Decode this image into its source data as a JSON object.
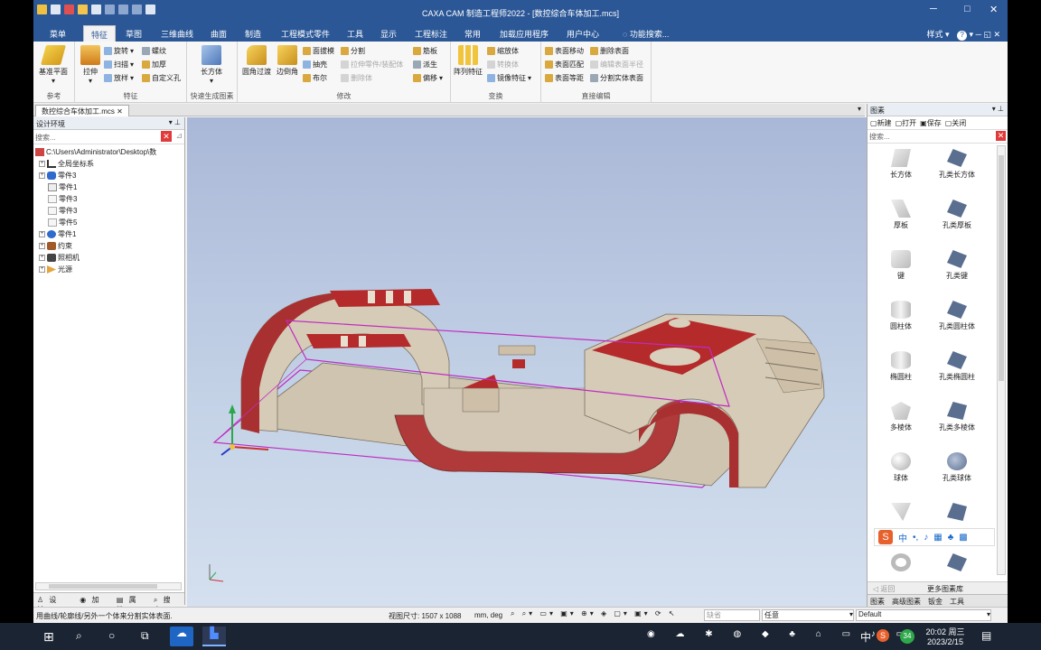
{
  "app": {
    "title": "CAXA CAM 制造工程师2022 - [数控综合车体加工.mcs]",
    "minimize": "─",
    "maximize": "□",
    "close": "✕"
  },
  "menu": {
    "tabs": [
      "菜单",
      "特征",
      "草图",
      "三维曲线",
      "曲面",
      "制造",
      "工程模式零件",
      "工具",
      "显示",
      "工程标注",
      "常用",
      "加载应用程序",
      "用户中心"
    ],
    "active_index": 1,
    "search_placeholder": "功能搜索...",
    "style_label": "样式",
    "help": "?"
  },
  "ribbon": {
    "groups": {
      "reference": {
        "label": "参考",
        "big": "基准平面"
      },
      "feature": {
        "label": "特征",
        "big": "拉伸",
        "small": [
          "旋转",
          "扫描",
          "放样",
          "螺纹",
          "加厚",
          "自定义孔"
        ]
      },
      "quick": {
        "label": "快速生成图素",
        "big": "长方体"
      },
      "modify": {
        "label": "修改",
        "big1": "圆角过渡",
        "big2": "边倒角",
        "small": [
          "面拔模",
          "抽壳",
          "布尔",
          "分割",
          "拉伸零件/装配体",
          "删除体",
          "筋板",
          "派生",
          "偏移"
        ]
      },
      "transform": {
        "label": "变换",
        "big": "阵列特征",
        "small": [
          "缩放体",
          "转换体",
          "镜像特征"
        ]
      },
      "direct": {
        "label": "直接编辑",
        "small": [
          "表面移动",
          "表面匹配",
          "表面等距",
          "删除表面",
          "编辑表面半径",
          "分割实体表面"
        ]
      }
    }
  },
  "document": {
    "tab": "数控综合车体加工.mcs"
  },
  "design_env": {
    "title": "设计环境",
    "search_placeholder": "搜索...",
    "tree": [
      {
        "label": "C:\\Users\\Administrator\\Desktop\\数",
        "level": 0
      },
      {
        "label": "全局坐标系",
        "level": 1
      },
      {
        "label": "零件3",
        "level": 1
      },
      {
        "label": "零件1",
        "level": 1
      },
      {
        "label": "零件3",
        "level": 1
      },
      {
        "label": "零件3",
        "level": 1
      },
      {
        "label": "零件5",
        "level": 1
      },
      {
        "label": "零件1",
        "level": 1
      },
      {
        "label": "约束",
        "level": 1
      },
      {
        "label": "照相机",
        "level": 1
      },
      {
        "label": "光源",
        "level": 1
      }
    ],
    "tabs": [
      "设计...",
      "加工",
      "属性",
      "搜索"
    ]
  },
  "library": {
    "title": "图素",
    "tools": [
      "新建",
      "打开",
      "保存",
      "关闭"
    ],
    "search_placeholder": "搜索...",
    "items": [
      [
        "长方体",
        "孔类长方体"
      ],
      [
        "厚板",
        "孔类厚板"
      ],
      [
        "键",
        "孔类键"
      ],
      [
        "圆柱体",
        "孔类圆柱体"
      ],
      [
        "椭圆柱",
        "孔类椭圆柱"
      ],
      [
        "多棱体",
        "孔类多棱体"
      ],
      [
        "球体",
        "孔类球体"
      ]
    ],
    "back": "返回",
    "more": "更多图素库",
    "tabs": [
      "图素",
      "高级图素",
      "钣金",
      "工具"
    ]
  },
  "status": {
    "hint": "用曲线/轮廓线/另外一个体来分割实体表面.",
    "viewsize": "视图尺寸: 1507 x 1088",
    "units": "mm, deg",
    "select1": "缺省",
    "select2": "任意",
    "select3": "Default"
  },
  "taskbar": {
    "time": "20:02 周三",
    "date": "2023/2/15",
    "ime": "中",
    "badge": "34"
  },
  "sogou": {
    "label": "中"
  },
  "colors": {
    "titlebar": "#2b5797",
    "part_body": "#d3c8b5",
    "part_red": "#b52a2a",
    "outline": "#c02bc0"
  }
}
